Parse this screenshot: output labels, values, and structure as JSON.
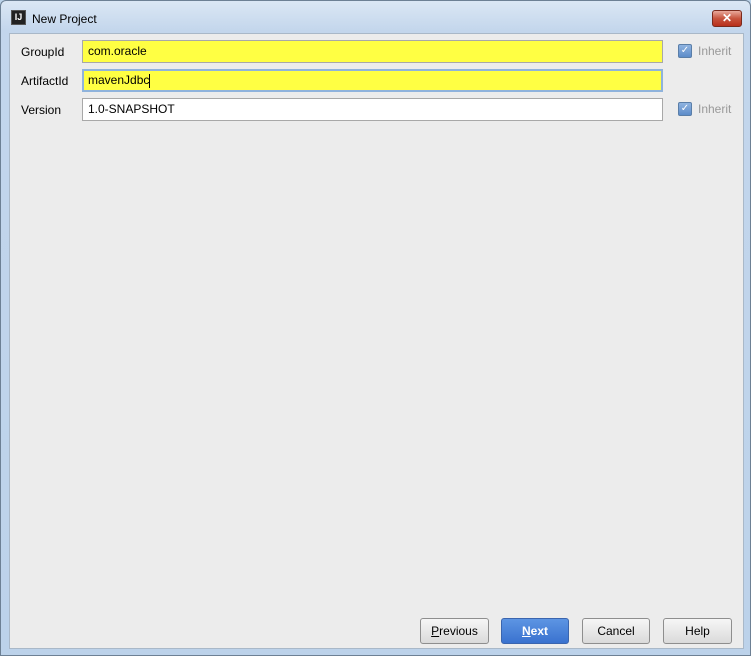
{
  "window": {
    "title": "New Project",
    "app_icon": "IJ"
  },
  "form": {
    "group_id": {
      "label": "GroupId",
      "value": "com.oracle",
      "inherit_label": "Inherit",
      "inherit_checked": true
    },
    "artifact_id": {
      "label": "ArtifactId",
      "value": "mavenJdbc"
    },
    "version": {
      "label": "Version",
      "value": "1.0-SNAPSHOT",
      "inherit_label": "Inherit",
      "inherit_checked": true
    }
  },
  "buttons": {
    "previous_mnemonic": "P",
    "previous_rest": "revious",
    "next_mnemonic": "N",
    "next_rest": "ext",
    "cancel": "Cancel",
    "help": "Help"
  },
  "colors": {
    "highlight": "#ffff43",
    "primary": "#3a72cf"
  }
}
